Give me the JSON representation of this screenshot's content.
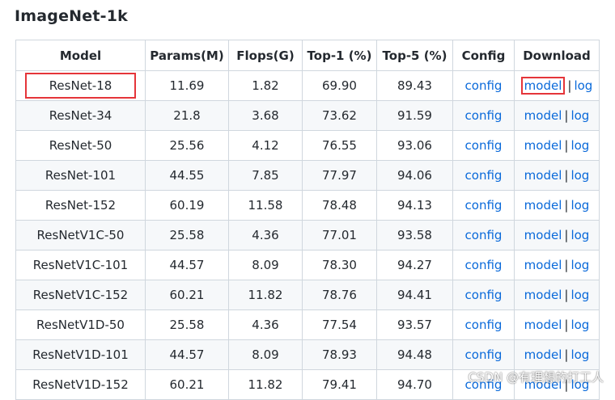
{
  "heading": "ImageNet-1k",
  "columns": [
    "Model",
    "Params(M)",
    "Flops(G)",
    "Top-1 (%)",
    "Top-5 (%)",
    "Config",
    "Download"
  ],
  "rows": [
    {
      "model": "ResNet-18",
      "params": "11.69",
      "flops": "1.82",
      "top1": "69.90",
      "top5": "89.43",
      "config": "config",
      "model_link": "model",
      "sep": "|",
      "log": "log"
    },
    {
      "model": "ResNet-34",
      "params": "21.8",
      "flops": "3.68",
      "top1": "73.62",
      "top5": "91.59",
      "config": "config",
      "model_link": "model",
      "sep": "|",
      "log": "log"
    },
    {
      "model": "ResNet-50",
      "params": "25.56",
      "flops": "4.12",
      "top1": "76.55",
      "top5": "93.06",
      "config": "config",
      "model_link": "model",
      "sep": "|",
      "log": "log"
    },
    {
      "model": "ResNet-101",
      "params": "44.55",
      "flops": "7.85",
      "top1": "77.97",
      "top5": "94.06",
      "config": "config",
      "model_link": "model",
      "sep": "|",
      "log": "log"
    },
    {
      "model": "ResNet-152",
      "params": "60.19",
      "flops": "11.58",
      "top1": "78.48",
      "top5": "94.13",
      "config": "config",
      "model_link": "model",
      "sep": "|",
      "log": "log"
    },
    {
      "model": "ResNetV1C-50",
      "params": "25.58",
      "flops": "4.36",
      "top1": "77.01",
      "top5": "93.58",
      "config": "config",
      "model_link": "model",
      "sep": "|",
      "log": "log"
    },
    {
      "model": "ResNetV1C-101",
      "params": "44.57",
      "flops": "8.09",
      "top1": "78.30",
      "top5": "94.27",
      "config": "config",
      "model_link": "model",
      "sep": "|",
      "log": "log"
    },
    {
      "model": "ResNetV1C-152",
      "params": "60.21",
      "flops": "11.82",
      "top1": "78.76",
      "top5": "94.41",
      "config": "config",
      "model_link": "model",
      "sep": "|",
      "log": "log"
    },
    {
      "model": "ResNetV1D-50",
      "params": "25.58",
      "flops": "4.36",
      "top1": "77.54",
      "top5": "93.57",
      "config": "config",
      "model_link": "model",
      "sep": "|",
      "log": "log"
    },
    {
      "model": "ResNetV1D-101",
      "params": "44.57",
      "flops": "8.09",
      "top1": "78.93",
      "top5": "94.48",
      "config": "config",
      "model_link": "model",
      "sep": "|",
      "log": "log"
    },
    {
      "model": "ResNetV1D-152",
      "params": "60.21",
      "flops": "11.82",
      "top1": "79.41",
      "top5": "94.70",
      "config": "config",
      "model_link": "model",
      "sep": "|",
      "log": "log"
    }
  ],
  "watermark": "CSDN @有理想的打工人",
  "colors": {
    "link": "#0969da",
    "highlight": "#e5353a",
    "border": "#d0d7de",
    "stripe": "#f6f8fa"
  }
}
